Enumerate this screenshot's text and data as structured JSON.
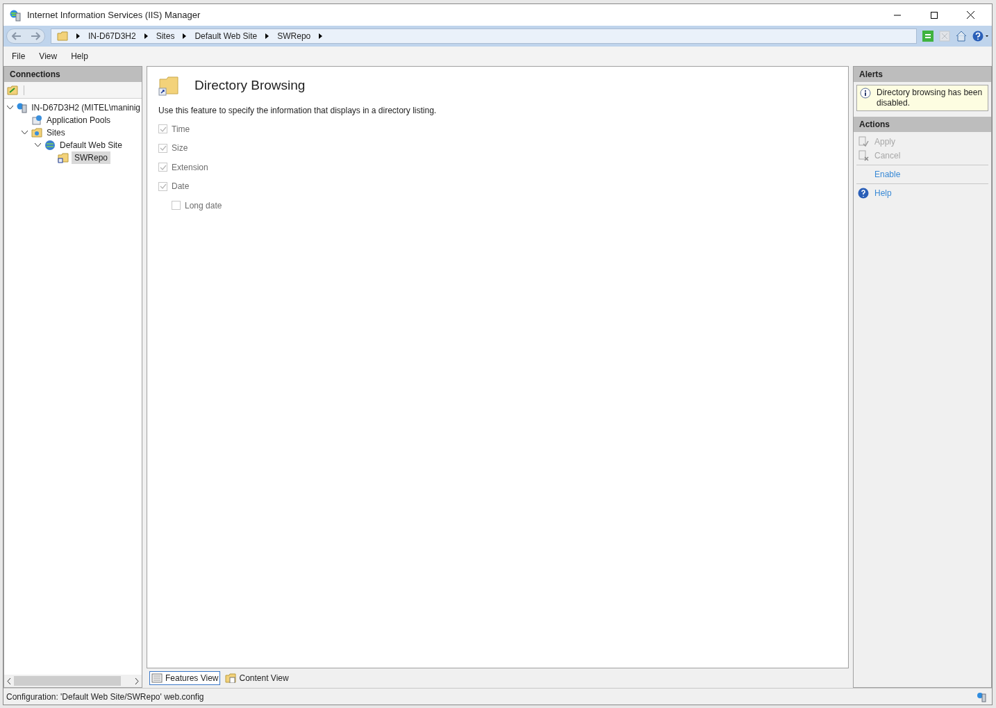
{
  "window": {
    "title": "Internet Information Services (IIS) Manager"
  },
  "address_bar": {
    "crumbs": [
      "IN-D67D3H2",
      "Sites",
      "Default Web Site",
      "SWRepo"
    ]
  },
  "menu": [
    "File",
    "View",
    "Help"
  ],
  "connections": {
    "title": "Connections",
    "tree": [
      {
        "label": "IN-D67D3H2 (MITEL\\maninig",
        "kind": "server",
        "expanded": true,
        "selected": false,
        "children": [
          {
            "label": "Application Pools",
            "kind": "pools",
            "selected": false
          },
          {
            "label": "Sites",
            "kind": "sites",
            "expanded": true,
            "selected": false,
            "children": [
              {
                "label": "Default Web Site",
                "kind": "site",
                "expanded": true,
                "selected": false,
                "children": [
                  {
                    "label": "SWRepo",
                    "kind": "folder",
                    "selected": true
                  }
                ]
              }
            ]
          }
        ]
      }
    ]
  },
  "feature": {
    "title": "Directory Browsing",
    "description": "Use this feature to specify the information that displays in a directory listing.",
    "options": [
      {
        "label": "Time",
        "checked": true,
        "disabled": true
      },
      {
        "label": "Size",
        "checked": true,
        "disabled": true
      },
      {
        "label": "Extension",
        "checked": true,
        "disabled": true
      },
      {
        "label": "Date",
        "checked": true,
        "disabled": true,
        "children": [
          {
            "label": "Long date",
            "checked": false,
            "disabled": true
          }
        ]
      }
    ]
  },
  "view_tabs": [
    {
      "label": "Features View",
      "selected": true
    },
    {
      "label": "Content View",
      "selected": false
    }
  ],
  "alerts": {
    "title": "Alerts",
    "message": "Directory browsing has been disabled."
  },
  "actions": {
    "title": "Actions",
    "items": [
      {
        "label": "Apply",
        "kind": "apply",
        "disabled": true
      },
      {
        "label": "Cancel",
        "kind": "cancel",
        "disabled": true
      },
      {
        "label": "Enable",
        "kind": "link",
        "disabled": false
      },
      {
        "label": "Help",
        "kind": "help",
        "disabled": false
      }
    ]
  },
  "status_bar": "Configuration: 'Default Web Site/SWRepo' web.config"
}
